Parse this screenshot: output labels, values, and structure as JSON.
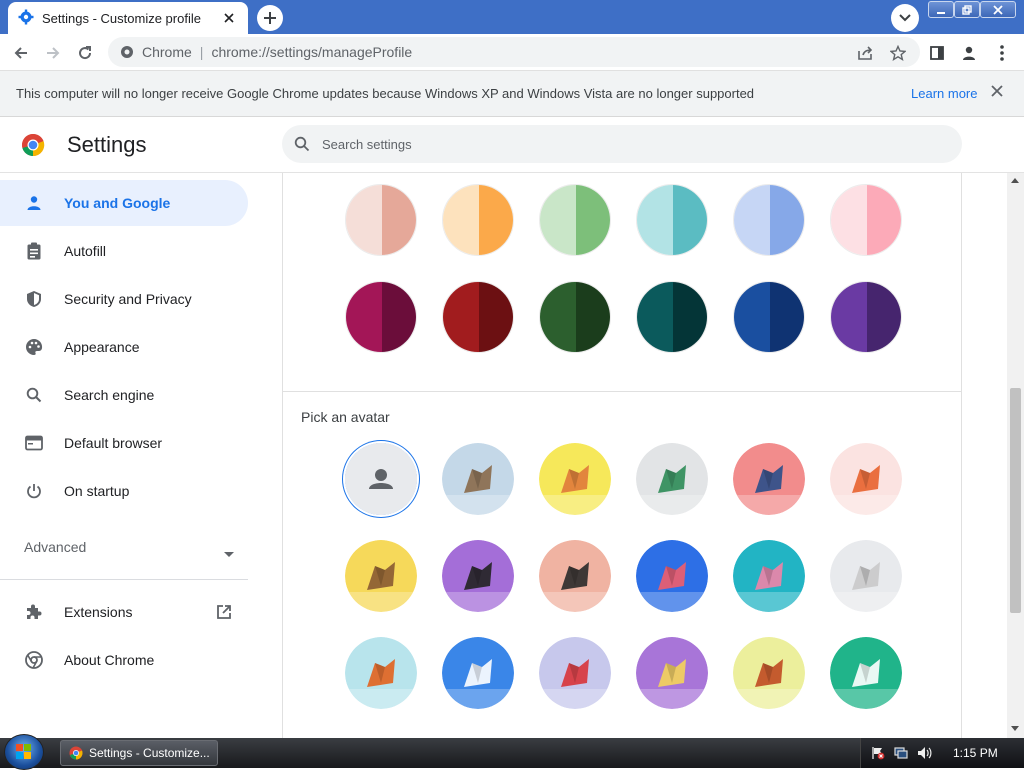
{
  "browser": {
    "tab_title": "Settings - Customize profile",
    "omnibox_site": "Chrome",
    "omnibox_url": "chrome://settings/manageProfile",
    "colors": {
      "titlebar": "#3e6fc6",
      "accent": "#1a73e8"
    }
  },
  "infobar": {
    "message": "This computer will no longer receive Google Chrome updates because Windows XP and Windows Vista are no longer supported",
    "learn_more": "Learn more"
  },
  "settings": {
    "title": "Settings",
    "search_placeholder": "Search settings"
  },
  "sidebar": {
    "items": [
      {
        "label": "You and Google",
        "icon": "person-icon",
        "active": true
      },
      {
        "label": "Autofill",
        "icon": "clipboard-icon"
      },
      {
        "label": "Security and Privacy",
        "icon": "shield-icon"
      },
      {
        "label": "Appearance",
        "icon": "palette-icon"
      },
      {
        "label": "Search engine",
        "icon": "search-icon"
      },
      {
        "label": "Default browser",
        "icon": "browser-icon"
      },
      {
        "label": "On startup",
        "icon": "power-icon"
      }
    ],
    "advanced_label": "Advanced",
    "extensions_label": "Extensions",
    "about_label": "About Chrome"
  },
  "themes": {
    "swatches": [
      {
        "left": "#f5ded8",
        "right": "#e5a899"
      },
      {
        "left": "#fde2bd",
        "right": "#fba94a"
      },
      {
        "left": "#c9e6c8",
        "right": "#7dbf7a"
      },
      {
        "left": "#b2e3e5",
        "right": "#5bbcc2"
      },
      {
        "left": "#c6d6f5",
        "right": "#86a8e8"
      },
      {
        "left": "#fde0e4",
        "right": "#fcaab8"
      },
      {
        "left": "#a31657",
        "right": "#6b0d3a"
      },
      {
        "left": "#a11c1e",
        "right": "#6c1012"
      },
      {
        "left": "#2c5f2e",
        "right": "#1b3d1c"
      },
      {
        "left": "#0b5a5c",
        "right": "#043537"
      },
      {
        "left": "#1a4fa0",
        "right": "#0f3372"
      },
      {
        "left": "#6a3aa3",
        "right": "#46256e"
      }
    ]
  },
  "avatars": {
    "heading": "Pick an avatar",
    "items": [
      {
        "name": "generic-avatar",
        "bg": "#e8eaed",
        "fg": "#5f6368",
        "selected": true
      },
      {
        "name": "cat-avatar",
        "bg": "#c4d8e8",
        "fg": "#8a6a4a"
      },
      {
        "name": "corgi-avatar",
        "bg": "#f6e85a",
        "fg": "#e07a3a"
      },
      {
        "name": "dragon-avatar",
        "bg": "#e2e4e6",
        "fg": "#2e8b57"
      },
      {
        "name": "elephant-avatar",
        "bg": "#f28c8c",
        "fg": "#2a4e8a"
      },
      {
        "name": "fox-avatar",
        "bg": "#fbe3e1",
        "fg": "#e8622e"
      },
      {
        "name": "monkey-avatar",
        "bg": "#f6d95a",
        "fg": "#8a5a32"
      },
      {
        "name": "panda-avatar",
        "bg": "#a46ed8",
        "fg": "#222222"
      },
      {
        "name": "penguin-avatar",
        "bg": "#f0b3a2",
        "fg": "#2a2a2a"
      },
      {
        "name": "butterfly-avatar",
        "bg": "#2d6fe6",
        "fg": "#f15d6a"
      },
      {
        "name": "rabbit-avatar",
        "bg": "#22b4c4",
        "fg": "#f083a8"
      },
      {
        "name": "unicorn-avatar",
        "bg": "#e8eaed",
        "fg": "#c9c9c9"
      },
      {
        "name": "basketball-avatar",
        "bg": "#b8e4ec",
        "fg": "#e2621e"
      },
      {
        "name": "bike-avatar",
        "bg": "#3a86e8",
        "fg": "#ffffff"
      },
      {
        "name": "bird-avatar",
        "bg": "#c7c8ec",
        "fg": "#d8343a"
      },
      {
        "name": "cheese-avatar",
        "bg": "#a875d8",
        "fg": "#f4d45a"
      },
      {
        "name": "football-avatar",
        "bg": "#ecef9c",
        "fg": "#c04a22"
      },
      {
        "name": "sushi-avatar",
        "bg": "#20b48a",
        "fg": "#ffffff"
      }
    ]
  },
  "taskbar": {
    "task_label": "Settings - Customize...",
    "clock": "1:15 PM"
  }
}
